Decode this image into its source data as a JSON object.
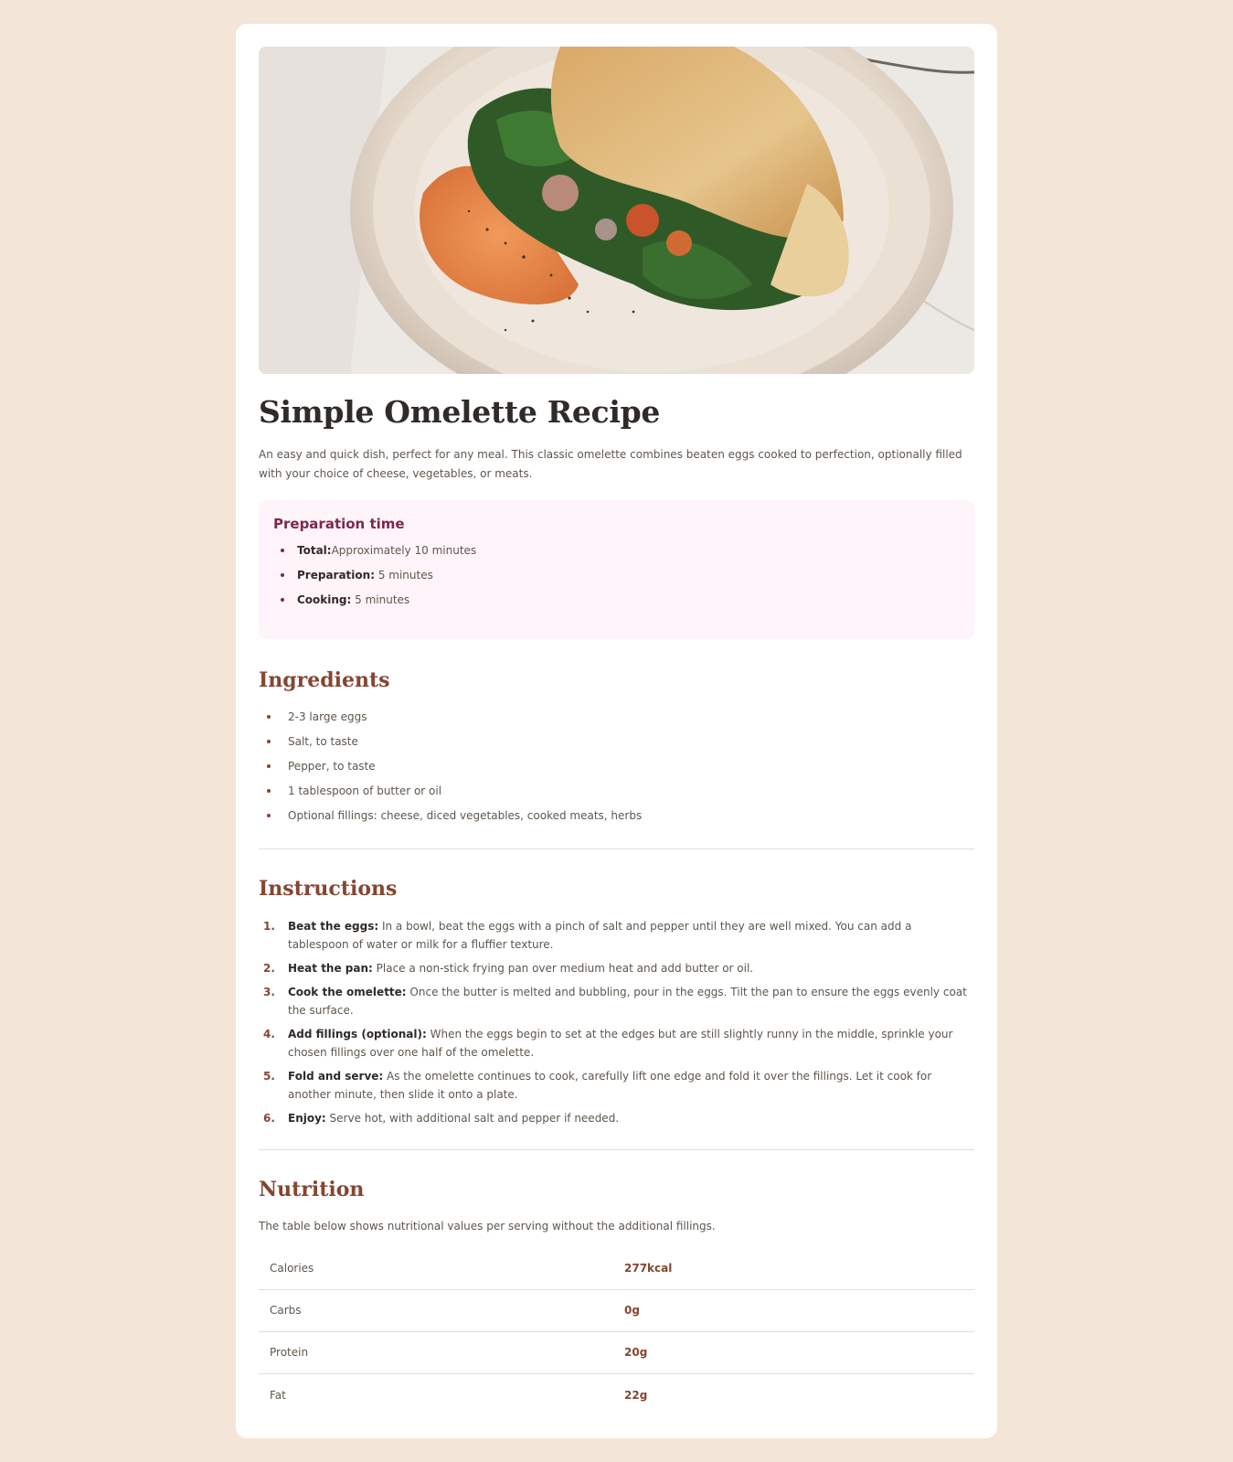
{
  "recipe": {
    "title": "Simple Omelette Recipe",
    "intro": "An easy and quick dish, perfect for any meal. This classic omelette combines beaten eggs cooked to perfection, optionally filled with your choice of cheese, vegetables, or meats."
  },
  "prep": {
    "title": "Preparation time",
    "items": [
      {
        "label": "Total:",
        "value": "Approximately 10 minutes"
      },
      {
        "label": "Preparation:",
        "value": " 5 minutes"
      },
      {
        "label": "Cooking:",
        "value": " 5 minutes"
      }
    ]
  },
  "ingredients": {
    "title": "Ingredients",
    "items": [
      "2-3 large eggs",
      "Salt, to taste",
      "Pepper, to taste",
      "1 tablespoon of butter or oil",
      "Optional fillings: cheese, diced vegetables, cooked meats, herbs"
    ]
  },
  "instructions": {
    "title": "Instructions",
    "steps": [
      {
        "num": "1.",
        "label": "Beat the eggs:",
        "text": " In a bowl, beat the eggs with a pinch of salt and pepper until they are well mixed. You can add a tablespoon of water or milk for a fluffier texture."
      },
      {
        "num": "2.",
        "label": "Heat the pan:",
        "text": " Place a non-stick frying pan over medium heat and add butter or oil."
      },
      {
        "num": "3.",
        "label": "Cook the omelette:",
        "text": " Once the butter is melted and bubbling, pour in the eggs. Tilt the pan to ensure the eggs evenly coat the surface."
      },
      {
        "num": "4.",
        "label": "Add fillings (optional):",
        "text": " When the eggs begin to set at the edges but are still slightly runny in the middle, sprinkle your chosen fillings over one half of the omelette."
      },
      {
        "num": "5.",
        "label": "Fold and serve:",
        "text": " As the omelette continues to cook, carefully lift one edge and fold it over the fillings. Let it cook for another minute, then slide it onto a plate."
      },
      {
        "num": "6.",
        "label": "Enjoy:",
        "text": " Serve hot, with additional salt and pepper if needed."
      }
    ]
  },
  "nutrition": {
    "title": "Nutrition",
    "note": "The table below shows nutritional values per serving without the additional fillings.",
    "rows": [
      {
        "label": "Calories",
        "value": "277kcal"
      },
      {
        "label": "Carbs",
        "value": "0g"
      },
      {
        "label": "Protein",
        "value": "20g"
      },
      {
        "label": "Fat",
        "value": "22g"
      }
    ]
  },
  "colors": {
    "background": "#f3e5d8",
    "accent": "#854632",
    "prep_accent": "#7b284f",
    "prep_bg": "#fef4f9"
  },
  "icons": [
    "omelette-photo"
  ]
}
